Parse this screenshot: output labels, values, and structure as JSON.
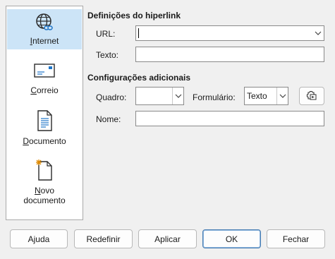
{
  "sidebar": {
    "items": [
      {
        "icon": "globe-link-icon",
        "label_first": "I",
        "label_rest": "nternet",
        "selected": true
      },
      {
        "icon": "envelope-icon",
        "label_first": "C",
        "label_rest": "orreio"
      },
      {
        "icon": "document-icon",
        "label_first": "D",
        "label_rest": "ocumento"
      },
      {
        "icon": "new-document-icon",
        "label_first": "N",
        "label_rest": "ovo",
        "label_line2": "documento"
      }
    ]
  },
  "hyperlink": {
    "heading": "Definições do hiperlink",
    "url_label": "URL:",
    "url_value": "",
    "text_label": "Texto:",
    "text_value": ""
  },
  "additional": {
    "heading": "Configurações adicionais",
    "frame_label": "Quadro:",
    "frame_value": "",
    "form_label": "Formulário:",
    "form_value": "Texto",
    "name_label": "Nome:",
    "name_value": ""
  },
  "footer": {
    "help": "Ajuda",
    "reset": "Redefinir",
    "apply": "Aplicar",
    "ok": "OK",
    "close": "Fechar"
  },
  "colors": {
    "selected_bg": "#cce4f7",
    "default_button_border": "#4a7fb3"
  }
}
